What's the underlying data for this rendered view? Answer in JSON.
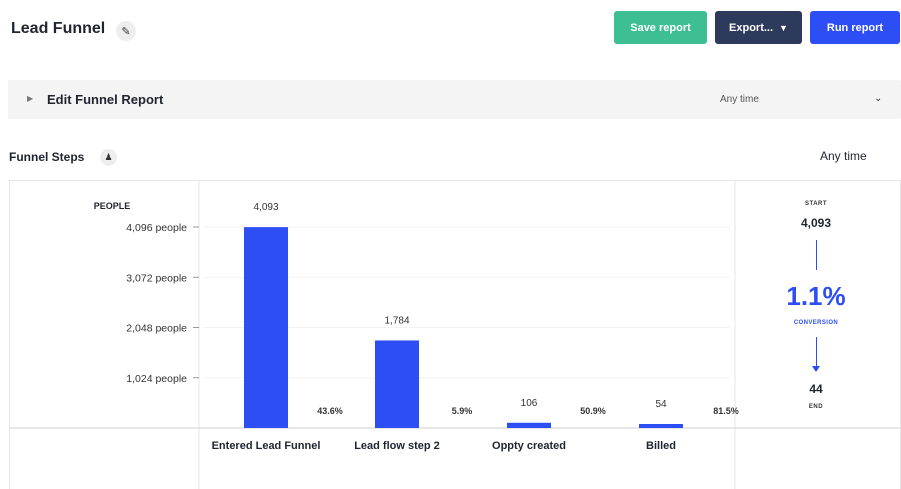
{
  "header": {
    "title": "Lead Funnel",
    "edit_icon": "pencil-icon",
    "save_label": "Save report",
    "export_label": "Export...",
    "export_icon": "chevron-down-icon",
    "run_label": "Run report"
  },
  "edit_bar": {
    "label": "Edit Funnel Report",
    "time_value": "Any time",
    "caret_icon": "caret-right-icon",
    "dropdown_icon": "chevron-down-icon"
  },
  "funnel": {
    "title": "Funnel Steps",
    "icon": "person-icon",
    "time_label": "Any time"
  },
  "summary": {
    "start_label": "START",
    "start_value": "4,093",
    "conversion": "1.1%",
    "conversion_label": "CONVERSION",
    "end_value": "44",
    "end_label": "END"
  },
  "colors": {
    "bar": "#2d4ef5",
    "save": "#3dbf93",
    "export": "#2d3a5c",
    "run": "#2d4ef5"
  },
  "chart_data": {
    "type": "bar",
    "ylabel": "PEOPLE",
    "ylim": [
      0,
      4096
    ],
    "yticks": [
      1024,
      2048,
      3072,
      4096
    ],
    "ytick_labels": [
      "1,024 people",
      "2,048 people",
      "3,072 people",
      "4,096 people"
    ],
    "categories": [
      "Entered Lead Funnel",
      "Lead flow step 2",
      "Oppty created",
      "Billed"
    ],
    "values": [
      4093,
      1784,
      106,
      54
    ],
    "value_labels": [
      "4,093",
      "1,784",
      "106",
      "54"
    ],
    "step_conversions": [
      "43.6%",
      "5.9%",
      "50.9%",
      "81.5%"
    ]
  }
}
